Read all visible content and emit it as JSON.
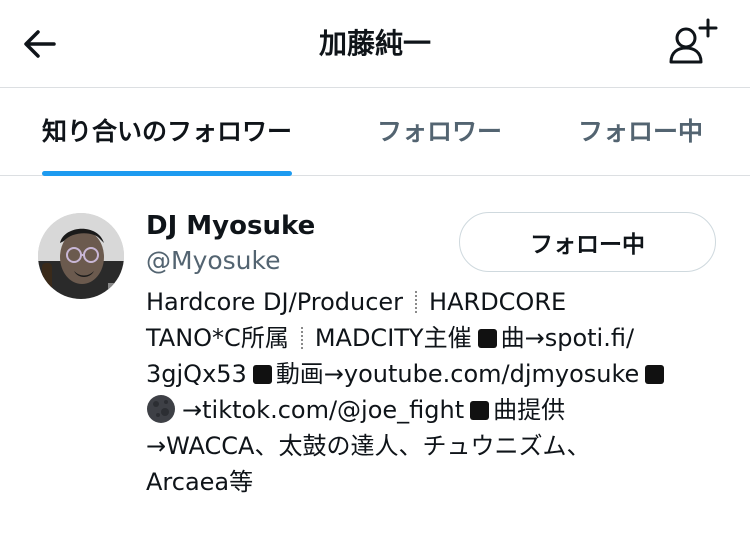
{
  "header": {
    "title": "加藤純一",
    "back_icon": "back-arrow-icon",
    "add_user_icon": "add-user-icon"
  },
  "tabs": [
    {
      "label": "知り合いのフォロワー",
      "active": true
    },
    {
      "label": "フォロワー",
      "active": false
    },
    {
      "label": "フォロー中",
      "active": false
    }
  ],
  "user": {
    "display_name": "DJ Myosuke",
    "handle": "@Myosuke",
    "follow_button_label": "フォロー中",
    "bio": {
      "line1a": "Hardcore DJ/Producer",
      "line1b": "HARDCORE",
      "line2a": "TANO*C所属",
      "line2b": "MADCITY主催",
      "line2c": "曲→spoti.fi/",
      "line3a": "3gjQx53",
      "line3b": "動画→youtube.com/djmyosuke",
      "line4a": "→tiktok.com/@joe_fight",
      "line4b": "曲提供",
      "line5": "→WACCA、太鼓の達人、チュウニズム、",
      "line6": "Arcaea等"
    }
  },
  "colors": {
    "accent": "#1d9bf0",
    "text_primary": "#0f1419",
    "text_secondary": "#536471",
    "divider": "#dcdfe2"
  }
}
